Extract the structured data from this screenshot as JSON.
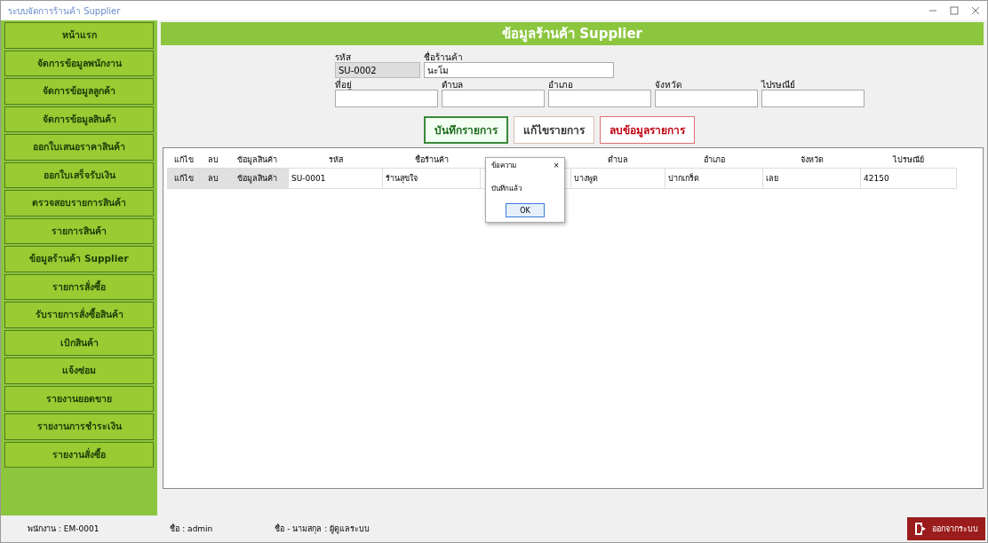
{
  "window": {
    "title": "ระบบจัดการร้านค้า Supplier"
  },
  "sidebar": {
    "items": [
      {
        "label": "หน้าแรก"
      },
      {
        "label": "จัดการข้อมูลพนักงาน"
      },
      {
        "label": "จัดการข้อมูลลูกค้า"
      },
      {
        "label": "จัดการข้อมูลสินค้า"
      },
      {
        "label": "ออกใบเสนอราคาสินค้า"
      },
      {
        "label": "ออกใบเสร็จรับเงิน"
      },
      {
        "label": "ตรวจสอบรายการสินค้า"
      },
      {
        "label": "รายการสินค้า"
      },
      {
        "label": "ข้อมูลร้านค้า Supplier"
      },
      {
        "label": "รายการสั่งซื้อ"
      },
      {
        "label": "รับรายการสั่งซื้อสินค้า"
      },
      {
        "label": "เบิกสินค้า"
      },
      {
        "label": "แจ้งซ่อม"
      },
      {
        "label": "รายงานยอดขาย"
      },
      {
        "label": "รายงานการชำระเงิน"
      },
      {
        "label": "รายงานสั่งซื้อ"
      }
    ]
  },
  "header": {
    "title": "ข้อมูลร้านค้า Supplier"
  },
  "form": {
    "code": {
      "label": "รหัส",
      "value": "SU-0002"
    },
    "name": {
      "label": "ชื่อร้านค้า",
      "value": "นะโม"
    },
    "address_fields": [
      {
        "label": "ที่อยู่"
      },
      {
        "label": "ตำบล"
      },
      {
        "label": "อำเภอ"
      },
      {
        "label": "จังหวัด"
      },
      {
        "label": "ไปรษณีย์"
      }
    ]
  },
  "buttons": [
    {
      "label": "บันทึกรายการ",
      "kind": "save"
    },
    {
      "label": "แก้ไขรายการ",
      "kind": "edit"
    },
    {
      "label": "ลบข้อมูลรายการ",
      "kind": "delete"
    }
  ],
  "table": {
    "columns": [
      "แก้ไข",
      "ลบ",
      "ข้อมูลสินค้า",
      "รหัส",
      "ชื่อร้านค้า",
      "ตำบล",
      "อำเภอ",
      "จังหวัด",
      "ไปรษณีย์"
    ],
    "rows": [
      {
        "cells": [
          "แก้ไข",
          "ลบ",
          "ข้อมูลสินค้า",
          "SU-0001",
          "ร้านสุขใจ",
          "บางพูด",
          "ปากเกร็ด",
          "เลย",
          "42150"
        ]
      }
    ]
  },
  "dialog": {
    "title": "ข้อความ",
    "close": "×",
    "message": "บันทึกแล้ว",
    "button": "OK"
  },
  "status_bar": {
    "employee": "พนักงาน : EM-0001",
    "user": "ชื่อ : admin",
    "fullname": "ชื่อ - นามสกุล : ผู้ดูแลระบบ",
    "logout": "ออกจากระบบ"
  }
}
